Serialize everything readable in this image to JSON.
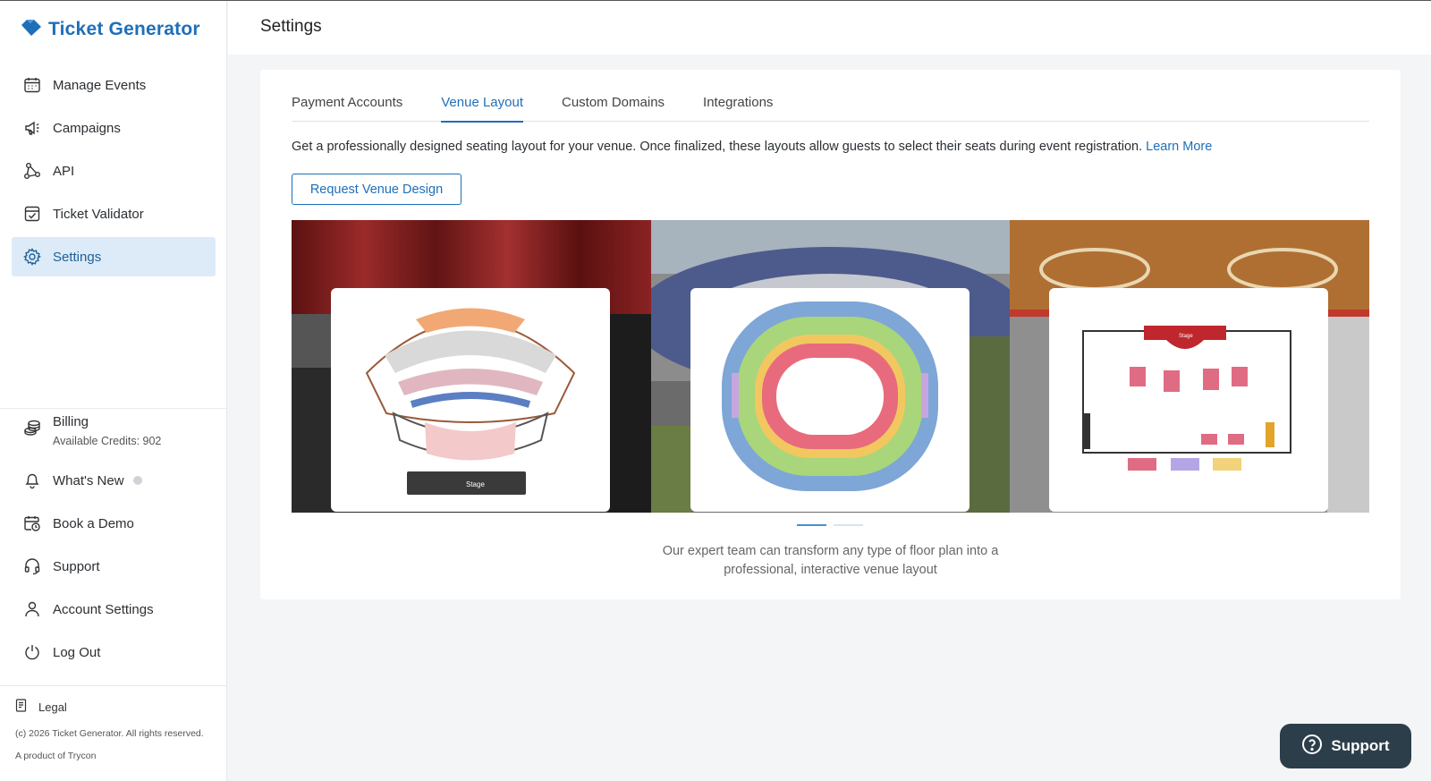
{
  "app": {
    "name": "Ticket Generator"
  },
  "sidebar": {
    "items": [
      {
        "label": "Manage Events",
        "icon": "calendar-icon"
      },
      {
        "label": "Campaigns",
        "icon": "megaphone-icon"
      },
      {
        "label": "API",
        "icon": "api-nodes-icon"
      },
      {
        "label": "Ticket Validator",
        "icon": "ticket-check-icon"
      },
      {
        "label": "Settings",
        "icon": "gear-icon",
        "active": true
      }
    ],
    "billing": {
      "label": "Billing",
      "credits": "Available Credits: 902"
    },
    "bottom_items": [
      {
        "label": "What's New",
        "icon": "bell-icon"
      },
      {
        "label": "Book a Demo",
        "icon": "calendar-clock-icon"
      },
      {
        "label": "Support",
        "icon": "headset-icon"
      },
      {
        "label": "Account Settings",
        "icon": "user-icon"
      },
      {
        "label": "Log Out",
        "icon": "power-icon"
      }
    ],
    "footer": {
      "legal": "Legal",
      "copyright": "(c) 2026 Ticket Generator. All rights reserved.",
      "product": "A product of Trycon"
    }
  },
  "header": {
    "title": "Settings"
  },
  "main": {
    "tabs": [
      {
        "label": "Payment Accounts"
      },
      {
        "label": "Venue Layout",
        "active": true
      },
      {
        "label": "Custom Domains"
      },
      {
        "label": "Integrations"
      }
    ],
    "description": "Get a professionally designed seating layout for your venue. Once finalized, these layouts allow guests to select their seats during event registration.",
    "learn_more": "Learn More",
    "request_button": "Request Venue Design",
    "slides": [
      {
        "name": "theater-layout",
        "label": "Stage"
      },
      {
        "name": "stadium-layout"
      },
      {
        "name": "banquet-layout",
        "label": "Stage"
      }
    ],
    "caption_line1": "Our expert team can transform any type of floor plan into a",
    "caption_line2": "professional, interactive venue layout"
  },
  "support_widget": {
    "label": "Support"
  },
  "colors": {
    "accent": "#1f6fb8",
    "active_bg": "#dcebf7",
    "support_bg": "#2d3e4b"
  }
}
